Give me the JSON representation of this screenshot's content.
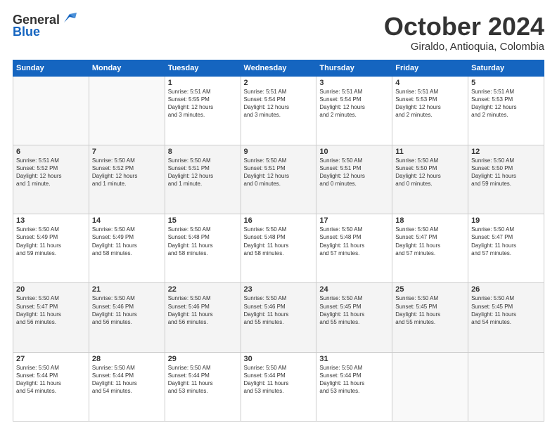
{
  "header": {
    "logo_general": "General",
    "logo_blue": "Blue",
    "month": "October 2024",
    "location": "Giraldo, Antioquia, Colombia"
  },
  "weekdays": [
    "Sunday",
    "Monday",
    "Tuesday",
    "Wednesday",
    "Thursday",
    "Friday",
    "Saturday"
  ],
  "weeks": [
    [
      {
        "day": "",
        "info": ""
      },
      {
        "day": "",
        "info": ""
      },
      {
        "day": "1",
        "info": "Sunrise: 5:51 AM\nSunset: 5:55 PM\nDaylight: 12 hours\nand 3 minutes."
      },
      {
        "day": "2",
        "info": "Sunrise: 5:51 AM\nSunset: 5:54 PM\nDaylight: 12 hours\nand 3 minutes."
      },
      {
        "day": "3",
        "info": "Sunrise: 5:51 AM\nSunset: 5:54 PM\nDaylight: 12 hours\nand 2 minutes."
      },
      {
        "day": "4",
        "info": "Sunrise: 5:51 AM\nSunset: 5:53 PM\nDaylight: 12 hours\nand 2 minutes."
      },
      {
        "day": "5",
        "info": "Sunrise: 5:51 AM\nSunset: 5:53 PM\nDaylight: 12 hours\nand 2 minutes."
      }
    ],
    [
      {
        "day": "6",
        "info": "Sunrise: 5:51 AM\nSunset: 5:52 PM\nDaylight: 12 hours\nand 1 minute."
      },
      {
        "day": "7",
        "info": "Sunrise: 5:50 AM\nSunset: 5:52 PM\nDaylight: 12 hours\nand 1 minute."
      },
      {
        "day": "8",
        "info": "Sunrise: 5:50 AM\nSunset: 5:51 PM\nDaylight: 12 hours\nand 1 minute."
      },
      {
        "day": "9",
        "info": "Sunrise: 5:50 AM\nSunset: 5:51 PM\nDaylight: 12 hours\nand 0 minutes."
      },
      {
        "day": "10",
        "info": "Sunrise: 5:50 AM\nSunset: 5:51 PM\nDaylight: 12 hours\nand 0 minutes."
      },
      {
        "day": "11",
        "info": "Sunrise: 5:50 AM\nSunset: 5:50 PM\nDaylight: 12 hours\nand 0 minutes."
      },
      {
        "day": "12",
        "info": "Sunrise: 5:50 AM\nSunset: 5:50 PM\nDaylight: 11 hours\nand 59 minutes."
      }
    ],
    [
      {
        "day": "13",
        "info": "Sunrise: 5:50 AM\nSunset: 5:49 PM\nDaylight: 11 hours\nand 59 minutes."
      },
      {
        "day": "14",
        "info": "Sunrise: 5:50 AM\nSunset: 5:49 PM\nDaylight: 11 hours\nand 58 minutes."
      },
      {
        "day": "15",
        "info": "Sunrise: 5:50 AM\nSunset: 5:48 PM\nDaylight: 11 hours\nand 58 minutes."
      },
      {
        "day": "16",
        "info": "Sunrise: 5:50 AM\nSunset: 5:48 PM\nDaylight: 11 hours\nand 58 minutes."
      },
      {
        "day": "17",
        "info": "Sunrise: 5:50 AM\nSunset: 5:48 PM\nDaylight: 11 hours\nand 57 minutes."
      },
      {
        "day": "18",
        "info": "Sunrise: 5:50 AM\nSunset: 5:47 PM\nDaylight: 11 hours\nand 57 minutes."
      },
      {
        "day": "19",
        "info": "Sunrise: 5:50 AM\nSunset: 5:47 PM\nDaylight: 11 hours\nand 57 minutes."
      }
    ],
    [
      {
        "day": "20",
        "info": "Sunrise: 5:50 AM\nSunset: 5:47 PM\nDaylight: 11 hours\nand 56 minutes."
      },
      {
        "day": "21",
        "info": "Sunrise: 5:50 AM\nSunset: 5:46 PM\nDaylight: 11 hours\nand 56 minutes."
      },
      {
        "day": "22",
        "info": "Sunrise: 5:50 AM\nSunset: 5:46 PM\nDaylight: 11 hours\nand 56 minutes."
      },
      {
        "day": "23",
        "info": "Sunrise: 5:50 AM\nSunset: 5:46 PM\nDaylight: 11 hours\nand 55 minutes."
      },
      {
        "day": "24",
        "info": "Sunrise: 5:50 AM\nSunset: 5:45 PM\nDaylight: 11 hours\nand 55 minutes."
      },
      {
        "day": "25",
        "info": "Sunrise: 5:50 AM\nSunset: 5:45 PM\nDaylight: 11 hours\nand 55 minutes."
      },
      {
        "day": "26",
        "info": "Sunrise: 5:50 AM\nSunset: 5:45 PM\nDaylight: 11 hours\nand 54 minutes."
      }
    ],
    [
      {
        "day": "27",
        "info": "Sunrise: 5:50 AM\nSunset: 5:44 PM\nDaylight: 11 hours\nand 54 minutes."
      },
      {
        "day": "28",
        "info": "Sunrise: 5:50 AM\nSunset: 5:44 PM\nDaylight: 11 hours\nand 54 minutes."
      },
      {
        "day": "29",
        "info": "Sunrise: 5:50 AM\nSunset: 5:44 PM\nDaylight: 11 hours\nand 53 minutes."
      },
      {
        "day": "30",
        "info": "Sunrise: 5:50 AM\nSunset: 5:44 PM\nDaylight: 11 hours\nand 53 minutes."
      },
      {
        "day": "31",
        "info": "Sunrise: 5:50 AM\nSunset: 5:44 PM\nDaylight: 11 hours\nand 53 minutes."
      },
      {
        "day": "",
        "info": ""
      },
      {
        "day": "",
        "info": ""
      }
    ]
  ]
}
